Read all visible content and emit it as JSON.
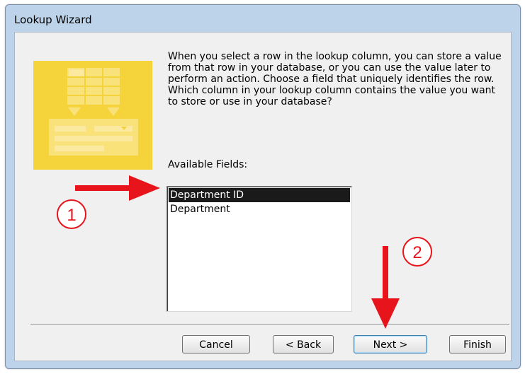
{
  "window": {
    "title": "Lookup Wizard"
  },
  "description": "When you select a row in the lookup column, you can store a value from that row in your database, or you can use the value later to perform an action.  Choose a field that uniquely identifies the row. Which column in your lookup column contains the value you want to store or use in your database?",
  "fields_label": "Available Fields:",
  "fields": [
    {
      "label": "Department ID",
      "selected": true
    },
    {
      "label": "Department",
      "selected": false
    }
  ],
  "buttons": {
    "cancel": "Cancel",
    "back": "< Back",
    "next": "Next >",
    "finish": "Finish"
  },
  "annotations": {
    "marker1": "1",
    "marker2": "2"
  },
  "colors": {
    "hero": "#f5d33b",
    "arrow": "#e8141c",
    "selection": "#1a1a1a"
  }
}
